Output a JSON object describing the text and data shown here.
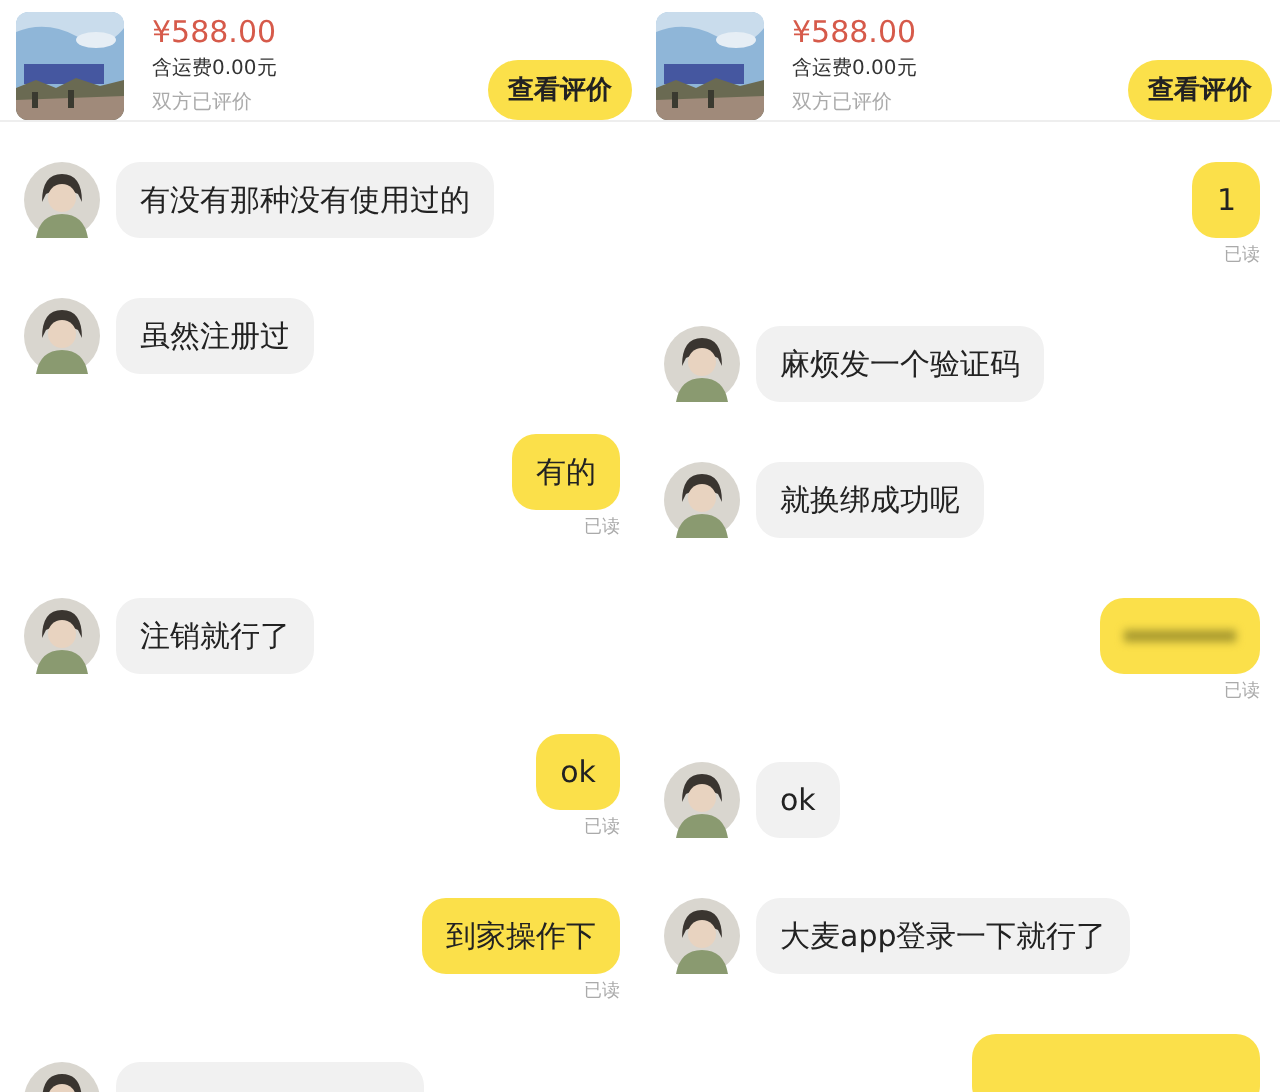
{
  "panels": [
    {
      "product": {
        "price": "¥588.00",
        "shipping": "含运费0.00元",
        "status": "双方已评价",
        "button": "查看评价"
      },
      "messages": [
        {
          "kind": "in",
          "text": "有没有那种没有使用过的"
        },
        {
          "kind": "in",
          "text": "虽然注册过"
        },
        {
          "kind": "out",
          "text": "有的",
          "read": "已读"
        },
        {
          "kind": "in",
          "text": "注销就行了"
        },
        {
          "kind": "out",
          "text": "ok",
          "read": "已读"
        },
        {
          "kind": "out",
          "text": "到家操作下",
          "read": "已读"
        },
        {
          "kind": "in-cut"
        }
      ]
    },
    {
      "product": {
        "price": "¥588.00",
        "shipping": "含运费0.00元",
        "status": "双方已评价",
        "button": "查看评价"
      },
      "messages": [
        {
          "kind": "out",
          "text": "1",
          "read": "已读"
        },
        {
          "kind": "in",
          "text": "麻烦发一个验证码"
        },
        {
          "kind": "in",
          "text": "就换绑成功呢"
        },
        {
          "kind": "redacted",
          "read": "已读"
        },
        {
          "kind": "in",
          "text": "ok"
        },
        {
          "kind": "in",
          "text": "大麦app登录一下就行了"
        },
        {
          "kind": "out-cut"
        }
      ]
    }
  ]
}
